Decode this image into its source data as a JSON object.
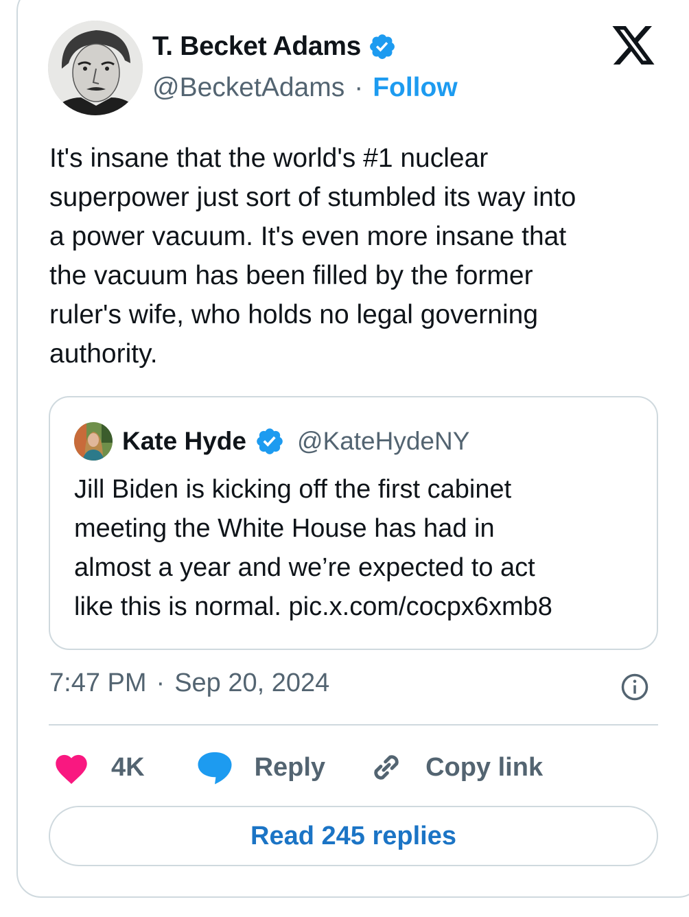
{
  "author": {
    "name": "T. Becket Adams",
    "handle": "@BecketAdams",
    "separator": "·",
    "follow_label": "Follow",
    "verified_color": "#1d9bf0"
  },
  "brand_icon": "x-logo-icon",
  "tweet": {
    "text": "It's insane that the world's #1 nuclear\nsuperpower just sort of stumbled its way into\na power vacuum. It's even more insane that\nthe vacuum has been filled by the former\nruler's wife, who holds no legal governing\nauthority."
  },
  "quoted_tweet": {
    "name": "Kate Hyde",
    "handle": "@KateHydeNY",
    "text": "Jill Biden is kicking off the first cabinet\nmeeting the White House has had in\nalmost a year and we’re expected to act\nlike this is normal.  pic.x.com/cocpx6xmb8"
  },
  "timestamp": {
    "time": "7:47 PM",
    "separator": "·",
    "date": "Sep 20, 2024"
  },
  "actions": {
    "like_count": "4K",
    "like_color": "#f91880",
    "reply_label": "Reply",
    "reply_color": "#1d9bf0",
    "copy_link_label": "Copy link"
  },
  "read_replies_label": "Read 245 replies"
}
